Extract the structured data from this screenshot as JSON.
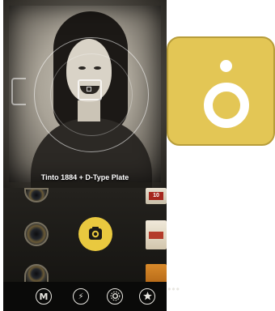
{
  "viewfinder": {
    "lens_label": "Tinto 1884 + D-Type Plate"
  },
  "film_labels": {
    "top": "10"
  },
  "bottom_bar": {
    "mode_label": "M",
    "flash_label": "⚡",
    "more_label": "•••"
  },
  "colors": {
    "accent_yellow": "#e9c93f",
    "tile_yellow": "#e3c655",
    "bar_background": "#0a0a09"
  },
  "icons": {
    "shutter": "camera-shutter-icon",
    "mode": "mode-m-icon",
    "flash": "flash-icon",
    "settings": "gear-icon",
    "favorites": "star-icon",
    "more": "more-dots-icon",
    "app": "app-logo-icon"
  }
}
